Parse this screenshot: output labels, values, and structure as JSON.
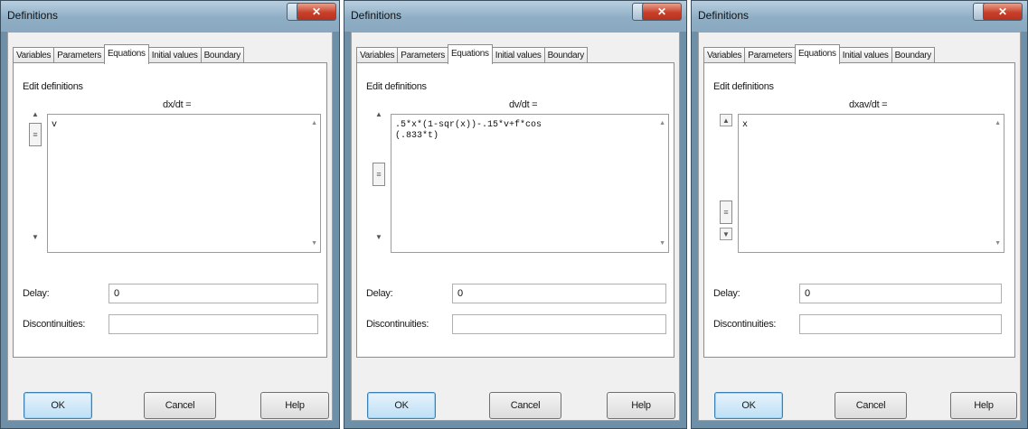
{
  "dialogs": [
    {
      "title": "Definitions",
      "tabs": [
        "Variables",
        "Parameters",
        "Equations",
        "Initial values",
        "Boundary"
      ],
      "active_tab": "Equations",
      "edit_label": "Edit definitions",
      "equation_label": "dx/dt =",
      "equation_text": "v",
      "delay_label": "Delay:",
      "delay_value": "0",
      "discontinuities_label": "Discontinuities:",
      "discontinuities_value": "",
      "ok_label": "OK",
      "cancel_label": "Cancel",
      "help_label": "Help"
    },
    {
      "title": "Definitions",
      "tabs": [
        "Variables",
        "Parameters",
        "Equations",
        "Initial values",
        "Boundary"
      ],
      "active_tab": "Equations",
      "edit_label": "Edit definitions",
      "equation_label": "dv/dt =",
      "equation_text": ".5*x*(1-sqr(x))-.15*v+f*cos\n(.833*t)",
      "delay_label": "Delay:",
      "delay_value": "0",
      "discontinuities_label": "Discontinuities:",
      "discontinuities_value": "",
      "ok_label": "OK",
      "cancel_label": "Cancel",
      "help_label": "Help"
    },
    {
      "title": "Definitions",
      "tabs": [
        "Variables",
        "Parameters",
        "Equations",
        "Initial values",
        "Boundary"
      ],
      "active_tab": "Equations",
      "edit_label": "Edit definitions",
      "equation_label": "dxav/dt =",
      "equation_text": "x",
      "delay_label": "Delay:",
      "delay_value": "0",
      "discontinuities_label": "Discontinuities:",
      "discontinuities_value": "",
      "ok_label": "OK",
      "cancel_label": "Cancel",
      "help_label": "Help"
    }
  ],
  "icons": {
    "help": "question-mark-icon",
    "close": "close-x-icon",
    "scroll_up": "up-arrow-icon",
    "scroll_down": "down-arrow-icon"
  },
  "colors": {
    "window_frame": "#6d8fa8",
    "titlebar": "#8eaec6",
    "close_button": "#c8402a",
    "default_button": "#bedff4",
    "dialog_face": "#f0f0f0"
  }
}
